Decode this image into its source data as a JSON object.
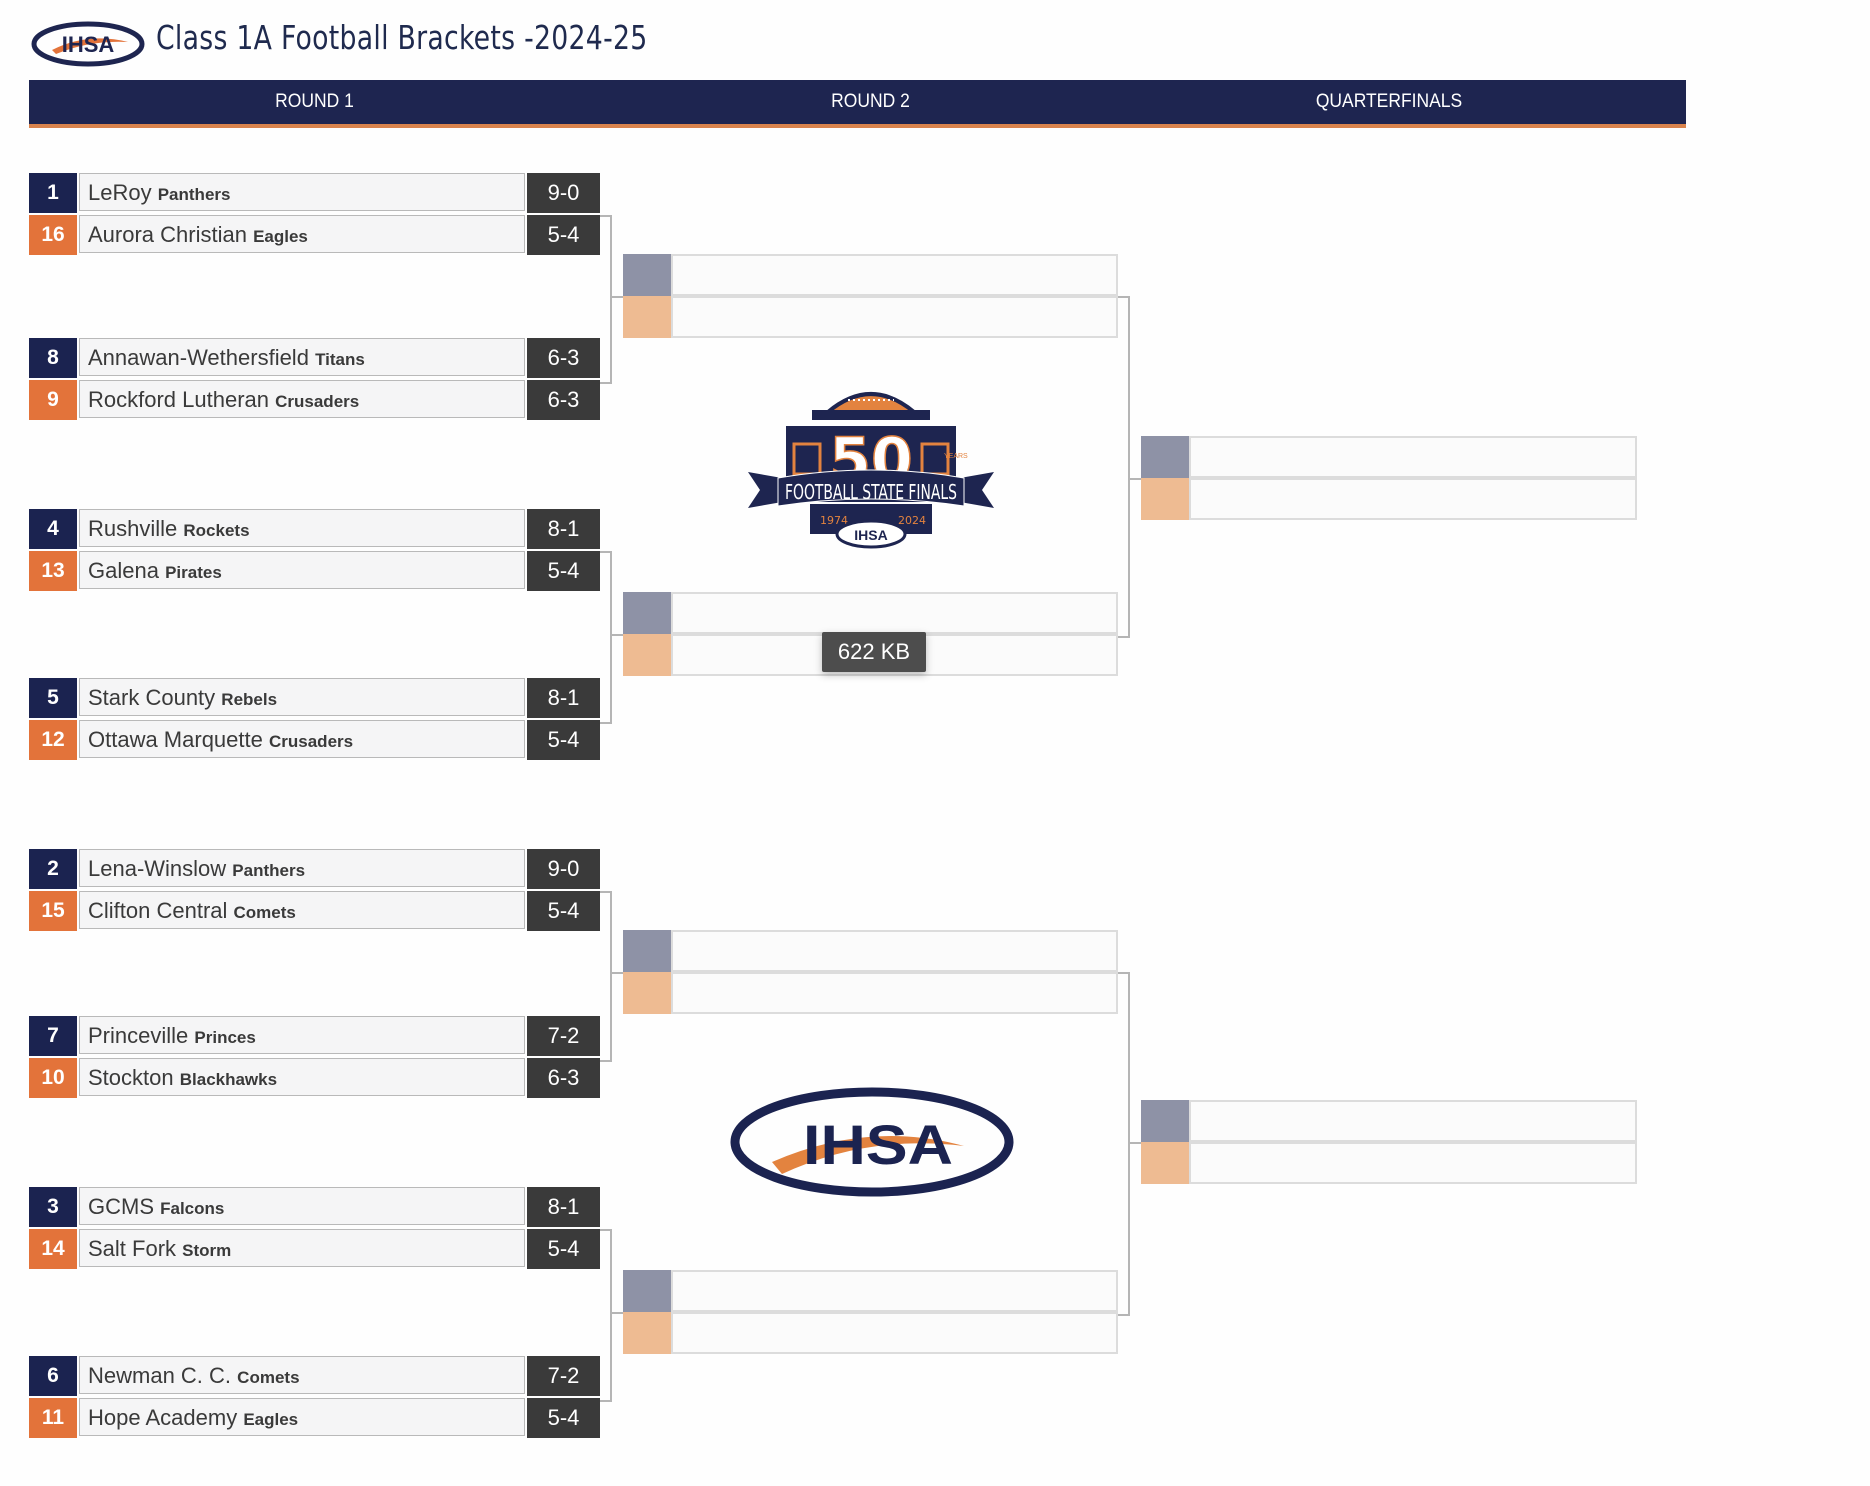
{
  "header": {
    "title": "Class 1A Football Brackets -2024-25",
    "logo_text": "IHSA"
  },
  "rounds": [
    "ROUND 1",
    "ROUND 2",
    "QUARTERFINALS"
  ],
  "colors": {
    "navy": "#1e2550",
    "orange": "#e3733a",
    "record_bg": "#3a3a3a",
    "slot_top": "#8e92a6",
    "slot_bottom": "#eebb92"
  },
  "round1": [
    {
      "top": {
        "seed": "1",
        "school": "LeRoy",
        "mascot": "Panthers",
        "record": "9-0"
      },
      "bottom": {
        "seed": "16",
        "school": "Aurora Christian",
        "mascot": "Eagles",
        "record": "5-4"
      }
    },
    {
      "top": {
        "seed": "8",
        "school": "Annawan-Wethersfield",
        "mascot": "Titans",
        "record": "6-3"
      },
      "bottom": {
        "seed": "9",
        "school": "Rockford Lutheran",
        "mascot": "Crusaders",
        "record": "6-3"
      }
    },
    {
      "top": {
        "seed": "4",
        "school": "Rushville",
        "mascot": "Rockets",
        "record": "8-1"
      },
      "bottom": {
        "seed": "13",
        "school": "Galena",
        "mascot": "Pirates",
        "record": "5-4"
      }
    },
    {
      "top": {
        "seed": "5",
        "school": "Stark County",
        "mascot": "Rebels",
        "record": "8-1"
      },
      "bottom": {
        "seed": "12",
        "school": "Ottawa Marquette",
        "mascot": "Crusaders",
        "record": "5-4"
      }
    },
    {
      "top": {
        "seed": "2",
        "school": "Lena-Winslow",
        "mascot": "Panthers",
        "record": "9-0"
      },
      "bottom": {
        "seed": "15",
        "school": "Clifton Central",
        "mascot": "Comets",
        "record": "5-4"
      }
    },
    {
      "top": {
        "seed": "7",
        "school": "Princeville",
        "mascot": "Princes",
        "record": "7-2"
      },
      "bottom": {
        "seed": "10",
        "school": "Stockton",
        "mascot": "Blackhawks",
        "record": "6-3"
      }
    },
    {
      "top": {
        "seed": "3",
        "school": "GCMS",
        "mascot": "Falcons",
        "record": "8-1"
      },
      "bottom": {
        "seed": "14",
        "school": "Salt Fork",
        "mascot": "Storm",
        "record": "5-4"
      }
    },
    {
      "top": {
        "seed": "6",
        "school": "Newman C. C.",
        "mascot": "Comets",
        "record": "7-2"
      },
      "bottom": {
        "seed": "11",
        "school": "Hope Academy",
        "mascot": "Eagles",
        "record": "5-4"
      }
    }
  ],
  "round2_slots": 4,
  "quarterfinal_slots": 2,
  "center_logo_1": {
    "number": "50",
    "years": "YEARS",
    "banner": "FOOTBALL STATE FINALS",
    "year_start": "1974",
    "year_end": "2024",
    "badge": "IHSA"
  },
  "center_logo_2": {
    "text": "IHSA"
  },
  "tooltip": "622 KB"
}
